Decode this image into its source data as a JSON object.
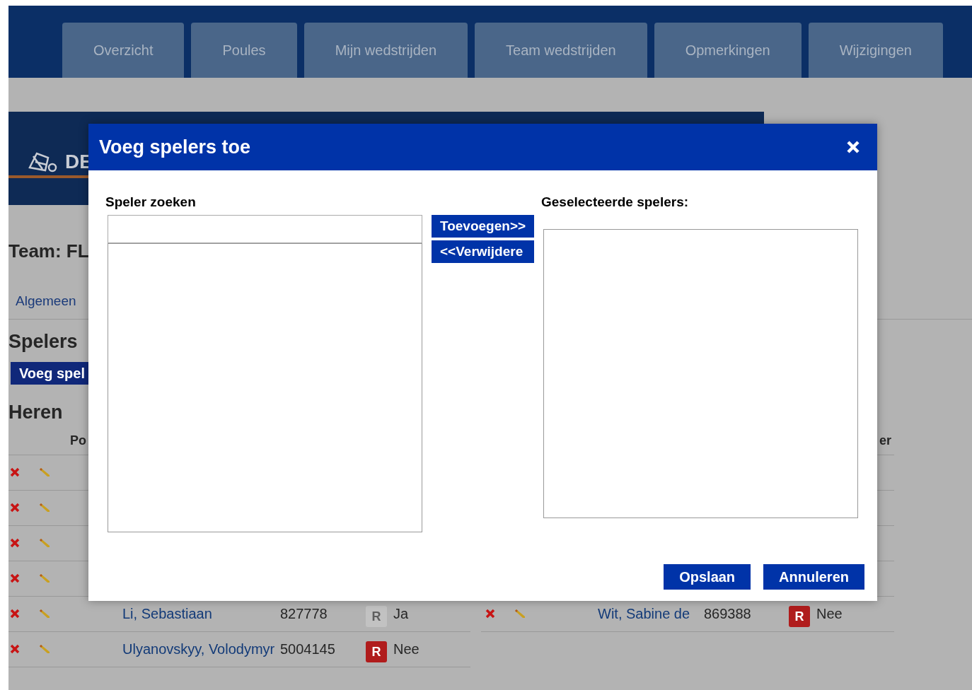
{
  "nav_tabs": [
    "Overzicht",
    "Poules",
    "Mijn wedstrijden",
    "Team wedstrijden",
    "Opmerkingen",
    "Wijzigingen"
  ],
  "banner": {
    "logo_text": "DE"
  },
  "team_title": "Team: FL",
  "subnav": [
    "Algemeen"
  ],
  "section_title": "Spelers",
  "add_button": "Voeg spel",
  "group_title": "Heren",
  "left_table": {
    "column_header": "Po",
    "rows": [
      {
        "kind": "icons_only"
      },
      {
        "kind": "icons_only"
      },
      {
        "kind": "icons_only"
      },
      {
        "kind": "icons_only"
      },
      {
        "kind": "full",
        "name": "Li, Sebastiaan",
        "number": "827778",
        "badge": "R",
        "r_active": false,
        "answer": "Ja"
      },
      {
        "kind": "full",
        "name": "Ulyanovskyy, Volodymyr",
        "number": "5004145",
        "badge": "R",
        "r_active": true,
        "answer": "Nee"
      }
    ]
  },
  "right_table": {
    "column_header": "er",
    "rows": [
      {
        "kind": "hidden"
      },
      {
        "kind": "hidden"
      },
      {
        "kind": "hidden"
      },
      {
        "kind": "hidden"
      },
      {
        "kind": "full",
        "name": "Wit, Sabine de",
        "number": "869388",
        "badge": "R",
        "r_active": true,
        "answer": "Nee"
      }
    ]
  },
  "modal": {
    "title": "Voeg spelers toe",
    "search_label": "Speler zoeken",
    "add_button": "Toevoegen>>",
    "remove_button": "<<Verwijdere",
    "selected_label": "Geselecteerde spelers:",
    "buttons": [
      "Opslaan",
      "Annuleren"
    ]
  }
}
